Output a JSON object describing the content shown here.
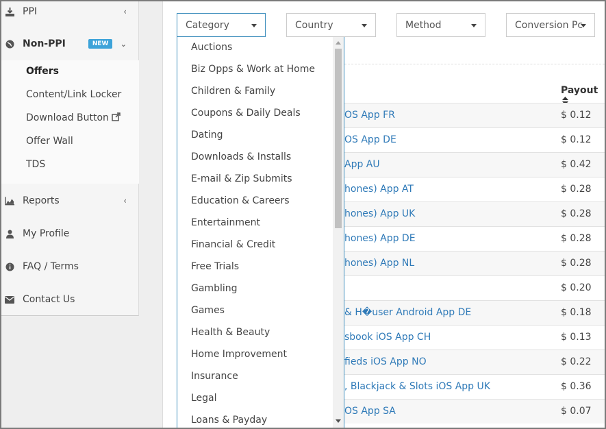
{
  "sidebar": {
    "ppi": {
      "label": "PPI",
      "icon": "download-icon"
    },
    "nonppi": {
      "label": "Non-PPI",
      "badge": "NEW",
      "icon": "globe-icon"
    },
    "submenu": [
      {
        "label": "Offers",
        "active": true
      },
      {
        "label": "Content/Link Locker"
      },
      {
        "label": "Download Button"
      },
      {
        "label": "Offer Wall"
      },
      {
        "label": "TDS"
      }
    ],
    "reports": {
      "label": "Reports",
      "icon": "area-chart-icon"
    },
    "profile": {
      "label": "My Profile",
      "icon": "user-icon"
    },
    "faq": {
      "label": "FAQ / Terms",
      "icon": "info-icon"
    },
    "contact": {
      "label": "Contact Us",
      "icon": "envelope-icon"
    }
  },
  "filters": {
    "category": "Category",
    "country": "Country",
    "method": "Method",
    "conversion": "Conversion Pc"
  },
  "table": {
    "payout_header": "Payout",
    "rows": [
      {
        "name": "OS App FR",
        "payout": "$ 0.12"
      },
      {
        "name": "OS App DE",
        "payout": "$ 0.12"
      },
      {
        "name": "App AU",
        "payout": "$ 0.42"
      },
      {
        "name": "hones) App AT",
        "payout": "$ 0.28"
      },
      {
        "name": "hones) App UK",
        "payout": "$ 0.28"
      },
      {
        "name": "hones) App DE",
        "payout": "$ 0.28"
      },
      {
        "name": "hones) App NL",
        "payout": "$ 0.28"
      },
      {
        "name": "",
        "payout": "$ 0.20"
      },
      {
        "name": "& H�user Android App DE",
        "payout": "$ 0.18"
      },
      {
        "name": "sbook iOS App CH",
        "payout": "$ 0.13"
      },
      {
        "name": "fieds iOS App NO",
        "payout": "$ 0.22"
      },
      {
        "name": ", Blackjack & Slots iOS App UK",
        "payout": "$ 0.36"
      },
      {
        "name": "OS App SA",
        "payout": "$ 0.07"
      }
    ]
  },
  "category_options": [
    "Auctions",
    "Biz Opps & Work at Home",
    "Children & Family",
    "Coupons & Daily Deals",
    "Dating",
    "Downloads & Installs",
    "E-mail & Zip Submits",
    "Education & Careers",
    "Entertainment",
    "Financial & Credit",
    "Free Trials",
    "Gambling",
    "Games",
    "Health & Beauty",
    "Home Improvement",
    "Insurance",
    "Legal",
    "Loans & Payday"
  ]
}
